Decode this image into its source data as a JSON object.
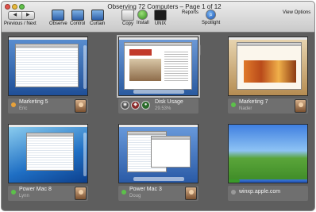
{
  "window": {
    "title": "Observing 72 Computers – Page 1 of 12"
  },
  "toolbar": {
    "nav": {
      "label": "Previous / Next",
      "prev": "◀",
      "next": "▶"
    },
    "buttons": [
      {
        "id": "observe",
        "label": "Observe"
      },
      {
        "id": "control",
        "label": "Control"
      },
      {
        "id": "curtain",
        "label": "Curtain"
      },
      {
        "id": "copy",
        "label": "Copy"
      },
      {
        "id": "install",
        "label": "Install"
      },
      {
        "id": "unix",
        "label": "UNIX"
      },
      {
        "id": "reports",
        "label": "Reports"
      },
      {
        "id": "spotlight",
        "label": "Spotlight"
      },
      {
        "id": "view-options",
        "label": "View Options"
      }
    ]
  },
  "computers": [
    {
      "name": "Marketing 5",
      "user": "Eric",
      "status_color": "#e8a23a",
      "screen": "finder"
    },
    {
      "name": "Disk Usage",
      "user": "29.53%",
      "status_color": "#5cc14a",
      "screen": "magazine"
    },
    {
      "name": "Marketing 7",
      "user": "Nader",
      "status_color": "#5cc14a",
      "screen": "presentation"
    },
    {
      "name": "Power Mac 8",
      "user": "Lynn",
      "status_color": "#5cc14a",
      "screen": "desktop"
    },
    {
      "name": "Power Mac 3",
      "user": "Doug",
      "status_color": "#5cc14a",
      "screen": "mailapp"
    },
    {
      "name": "winxp.apple.com",
      "user": "",
      "status_color": "#9a9a9a",
      "screen": "xp"
    }
  ]
}
